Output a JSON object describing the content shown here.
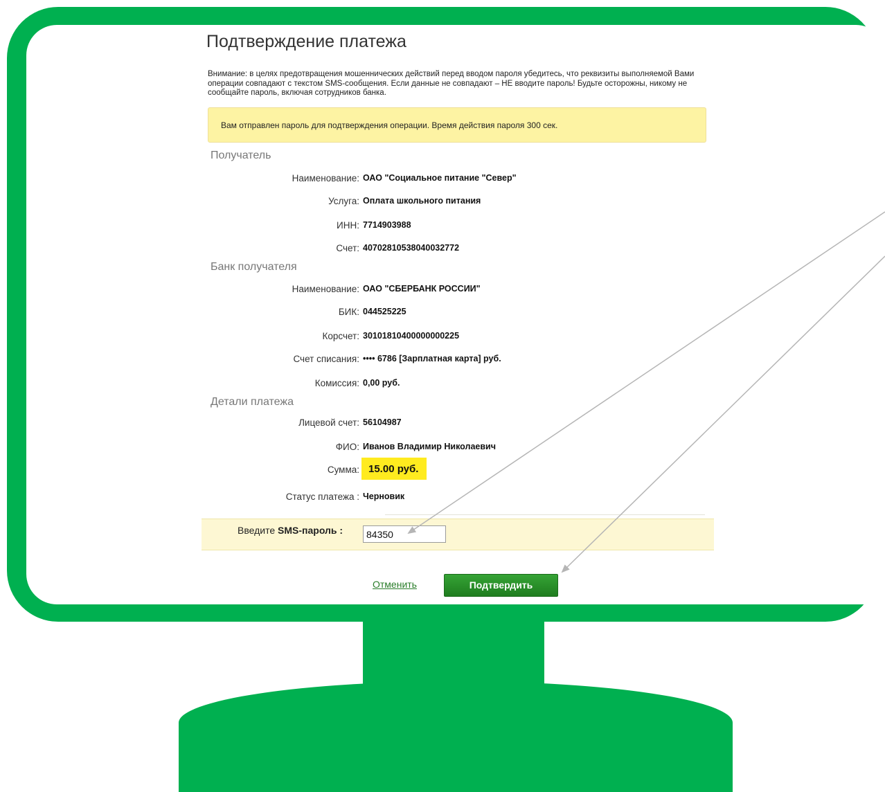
{
  "page": {
    "title": "Подтверждение платежа",
    "warning": "Внимание: в целях предотвращения мошеннических действий перед вводом пароля убедитесь, что реквизиты выполняемой Вами операции совпадают с текстом SMS-сообщения. Если данные не совпадают – НЕ вводите пароль! Будьте осторожны, никому не сообщайте пароль, включая сотрудников банка.",
    "notice": "Вам отправлен пароль для подтверждения операции. Время действия пароля 300 сек."
  },
  "recipient": {
    "heading": "Получатель",
    "name_label": "Наименование:",
    "name_value": "ОАО \"Социальное питание \"Север\"",
    "service_label": "Услуга:",
    "service_value": "Оплата школьного питания",
    "inn_label": "ИНН:",
    "inn_value": "7714903988",
    "account_label": "Счет:",
    "account_value": "40702810538040032772"
  },
  "bank": {
    "heading": "Банк получателя",
    "name_label": "Наименование:",
    "name_value": "ОАО \"СБЕРБАНК РОССИИ\"",
    "bik_label": "БИК:",
    "bik_value": "044525225",
    "corr_label": "Корсчет:",
    "corr_value": "30101810400000000225",
    "debit_label": "Счет списания:",
    "debit_value": "•••• 6786  [Зарплатная карта]  руб.",
    "fee_label": "Комиссия:",
    "fee_value": "0,00 руб."
  },
  "details": {
    "heading": "Детали платежа",
    "personal_account_label": "Лицевой счет:",
    "personal_account_value": "56104987",
    "fio_label": "ФИО:",
    "fio_value": "Иванов Владимир Николаевич",
    "amount_label": "Сумма:",
    "amount_value": "15.00 руб.",
    "status_label": "Статус платежа :",
    "status_value": "Черновик"
  },
  "sms": {
    "label_prefix": "Введите ",
    "label_bold": "SMS-пароль :",
    "value": "84350"
  },
  "actions": {
    "cancel": "Отменить",
    "confirm": "Подтвердить"
  },
  "colors": {
    "frame": "#00b050",
    "notice_bg": "#fdf3a3",
    "amount_highlight": "#ffeb1f",
    "button": "#2a8f2a"
  }
}
